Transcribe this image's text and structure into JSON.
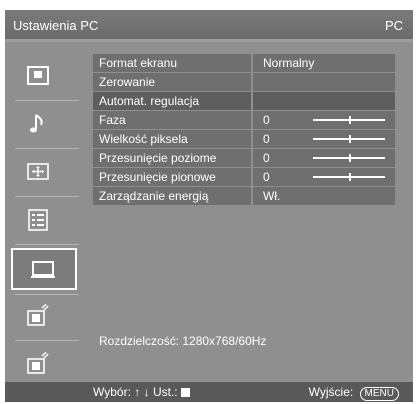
{
  "title": {
    "left": "Ustawienia PC",
    "right": "PC"
  },
  "sidebar": {
    "items": [
      {
        "icon": "picture-icon"
      },
      {
        "icon": "sound-note-icon"
      },
      {
        "icon": "screen-adjust-icon"
      },
      {
        "icon": "setup-list-icon"
      },
      {
        "icon": "pc-monitor-icon",
        "active": true
      },
      {
        "icon": "analog-input-icon"
      },
      {
        "icon": "digital-input-icon"
      }
    ]
  },
  "menu": {
    "rows": [
      {
        "label": "Format ekranu",
        "value": "Normalny"
      },
      {
        "label": "Zerowanie",
        "value": ""
      },
      {
        "label": "Automat. regulacja",
        "value": ""
      },
      {
        "label": "Faza",
        "value": "0",
        "level": 0.5
      },
      {
        "label": "Wielkość piksela",
        "value": "0",
        "level": 0.5
      },
      {
        "label": "Przesunięcie poziome",
        "value": "0",
        "level": 0.5
      },
      {
        "label": "Przesunięcie pionowe",
        "value": "0",
        "level": 0.5
      },
      {
        "label": "Zarządzanie energią",
        "value": "Wł."
      }
    ]
  },
  "resolution": "Rozdzielczość: 1280x768/60Hz",
  "footer": {
    "nav_label": "Wybór:",
    "nav_arrows": "↑ ↓",
    "set_label": "Ust.:",
    "exit_label": "Wyjście:",
    "menu_key": "MENU"
  }
}
